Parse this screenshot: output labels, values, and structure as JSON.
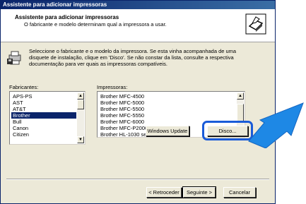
{
  "window": {
    "title": "Assistente para adicionar impressoras"
  },
  "header": {
    "title": "Assistente para adicionar impressoras",
    "subtitle": "O fabricante e modelo determinam qual a impressora a usar."
  },
  "intro": {
    "line1": "Seleccione o fabricante e o modelo da impressora. Se esta vinha acompanhada de uma",
    "line2": "disquete de instalação, clique em 'Disco'. Se não constar da lista, consulte a respectiva",
    "line3": "documentação para ver quais as impressoras compatíveis."
  },
  "manufacturers": {
    "label": "Fabricantes:",
    "items": [
      "APS-PS",
      "AST",
      "AT&T",
      "Brother",
      "Bull",
      "Canon",
      "Citizen"
    ],
    "selected": "Brother"
  },
  "printers": {
    "label": "Impressoras:",
    "items": [
      "Brother MFC-4500",
      "Brother MFC-5000",
      "Brother MFC-5500",
      "Brother MFC-5550",
      "Brother MFC-6000",
      "Brother MFC-P2000",
      "Brother HL-1030 series"
    ]
  },
  "buttons": {
    "windows_update": "Windows Update",
    "disk": "Disco...",
    "back": "< Retroceder",
    "next": "Seguinte >",
    "cancel": "Cancelar"
  },
  "colors": {
    "highlight": "#1a5bd8",
    "arrow": "#1e88e5",
    "selection": "#0a246a"
  }
}
